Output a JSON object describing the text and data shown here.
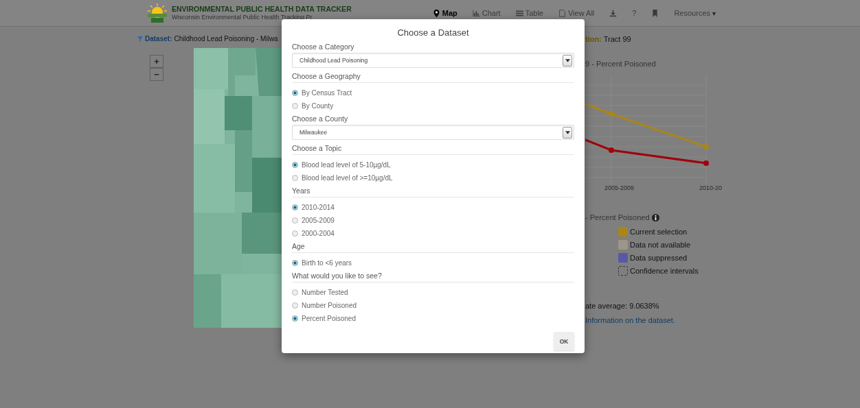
{
  "header": {
    "title": "ENVIRONMENTAL PUBLIC HEALTH DATA TRACKER",
    "subtitle": "Wisconsin Environmental Public Health Tracking Pr",
    "nav": [
      {
        "label": "Map",
        "selected": true
      },
      {
        "label": "Chart",
        "selected": false
      },
      {
        "label": "Table",
        "selected": false
      },
      {
        "label": "View All",
        "selected": false
      },
      {
        "selected": false
      },
      {
        "label": "?",
        "selected": false
      },
      {
        "selected": false
      },
      {
        "label": "Resources",
        "caret": "▾",
        "selected": false
      }
    ]
  },
  "dataset": {
    "label": "Dataset:",
    "value": "Childhood Lead Poisoning - Milwa"
  },
  "zoom": [
    "+",
    "−"
  ],
  "selection": {
    "label": "tion:",
    "value": "Tract 99"
  },
  "chart": {
    "title": "9 - Percent Poisoned",
    "x_labels": [
      "2005-2009",
      "2010-20"
    ]
  },
  "legend": {
    "title": "- Percent Poisoned",
    "items": [
      {
        "label": "Current selection",
        "kind": "swatch",
        "color": "#a8861a"
      },
      {
        "label": "Data not available",
        "kind": "swatch",
        "color": "#9c958a"
      },
      {
        "label": "Data suppressed",
        "kind": "swatch",
        "color": "#5b57a8"
      },
      {
        "label": "Confidence intervals",
        "kind": "dashed"
      }
    ]
  },
  "state_average": "ate average: 9.0638%",
  "info_link": "Information on the dataset.",
  "modal": {
    "title": "Choose a Dataset",
    "sections": [
      {
        "label": "Choose a Category",
        "kind": "select",
        "value": "Childhood Lead Poisoning"
      },
      {
        "label": "Choose a Geography",
        "kind": "radio",
        "options": [
          {
            "label": "By Census Tract",
            "selected": true
          },
          {
            "label": "By County",
            "selected": false
          }
        ]
      },
      {
        "label": "Choose a County",
        "kind": "select",
        "value": "Milwaukee"
      },
      {
        "label": "Choose a Topic",
        "kind": "radio",
        "options": [
          {
            "label": "Blood lead level of 5-10µg/dL",
            "selected": true
          },
          {
            "label": "Blood lead level of >=10µg/dL",
            "selected": false
          }
        ]
      },
      {
        "label": "Years",
        "kind": "radio",
        "options": [
          {
            "label": "2010-2014",
            "selected": true
          },
          {
            "label": "2005-2009",
            "selected": false
          },
          {
            "label": "2000-2004",
            "selected": false
          }
        ]
      },
      {
        "label": "Age",
        "kind": "radio",
        "options": [
          {
            "label": "Birth to <6 years",
            "selected": true
          }
        ]
      },
      {
        "label": "What would you like to see?",
        "kind": "radio",
        "options": [
          {
            "label": "Number Tested",
            "selected": false
          },
          {
            "label": "Number Poisoned",
            "selected": false
          },
          {
            "label": "Percent Poisoned",
            "selected": true
          }
        ]
      }
    ],
    "button": "OK"
  }
}
